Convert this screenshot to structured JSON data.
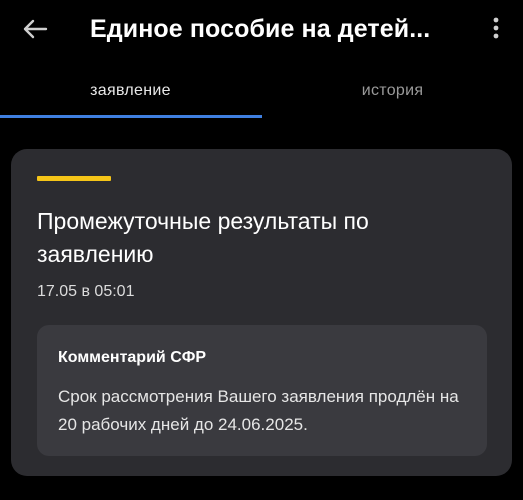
{
  "header": {
    "title": "Единое пособие на детей...",
    "back_icon": "arrow-left-icon",
    "more_icon": "more-vertical-icon"
  },
  "tabs": [
    {
      "label": "заявление",
      "active": true
    },
    {
      "label": "история",
      "active": false
    }
  ],
  "card": {
    "title": "Промежуточные результаты по заявлению",
    "datetime": "17.05 в 05:01",
    "comment": {
      "title": "Комментарий СФР",
      "text": "Срок рассмотрения Вашего заявления продлён на 20 рабочих дней до 24.06.2025."
    }
  },
  "colors": {
    "background": "#000000",
    "card": "#2c2c30",
    "comment_box": "#3a3a3f",
    "accent": "#f5c518",
    "tab_indicator": "#3f7fe0"
  }
}
